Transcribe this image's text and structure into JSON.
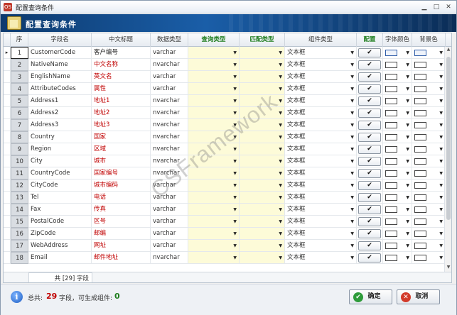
{
  "window": {
    "title": "配置查询条件",
    "app_icon": "OS"
  },
  "banner": {
    "title": "配置查询条件"
  },
  "grid": {
    "headers": {
      "seq": "序",
      "field": "字段名",
      "cn": "中文标题",
      "type": "数据类型",
      "query": "查询类型",
      "match": "匹配类型",
      "comp": "组件类型",
      "cfg": "配置",
      "fc": "字体颜色",
      "bg": "背景色"
    },
    "rows": [
      {
        "seq": "1",
        "field": "CustomerCode",
        "cn": "客户编号",
        "type": "varchar",
        "comp": "文本框"
      },
      {
        "seq": "2",
        "field": "NativeName",
        "cn": "中文名称",
        "type": "nvarchar",
        "comp": "文本框"
      },
      {
        "seq": "3",
        "field": "EnglishName",
        "cn": "英文名",
        "type": "varchar",
        "comp": "文本框"
      },
      {
        "seq": "4",
        "field": "AttributeCodes",
        "cn": "属性",
        "type": "varchar",
        "comp": "文本框"
      },
      {
        "seq": "5",
        "field": "Address1",
        "cn": "地址1",
        "type": "nvarchar",
        "comp": "文本框"
      },
      {
        "seq": "6",
        "field": "Address2",
        "cn": "地址2",
        "type": "nvarchar",
        "comp": "文本框"
      },
      {
        "seq": "7",
        "field": "Address3",
        "cn": "地址3",
        "type": "nvarchar",
        "comp": "文本框"
      },
      {
        "seq": "8",
        "field": "Country",
        "cn": "国家",
        "type": "nvarchar",
        "comp": "文本框"
      },
      {
        "seq": "9",
        "field": "Region",
        "cn": "区域",
        "type": "nvarchar",
        "comp": "文本框"
      },
      {
        "seq": "10",
        "field": "City",
        "cn": "城市",
        "type": "nvarchar",
        "comp": "文本框"
      },
      {
        "seq": "11",
        "field": "CountryCode",
        "cn": "国家编号",
        "type": "nvarchar",
        "comp": "文本框"
      },
      {
        "seq": "12",
        "field": "CityCode",
        "cn": "城市编码",
        "type": "varchar",
        "comp": "文本框"
      },
      {
        "seq": "13",
        "field": "Tel",
        "cn": "电话",
        "type": "varchar",
        "comp": "文本框"
      },
      {
        "seq": "14",
        "field": "Fax",
        "cn": "传真",
        "type": "varchar",
        "comp": "文本框"
      },
      {
        "seq": "15",
        "field": "PostalCode",
        "cn": "区号",
        "type": "varchar",
        "comp": "文本框"
      },
      {
        "seq": "16",
        "field": "ZipCode",
        "cn": "邮编",
        "type": "varchar",
        "comp": "文本框"
      },
      {
        "seq": "17",
        "field": "WebAddress",
        "cn": "网址",
        "type": "varchar",
        "comp": "文本框"
      },
      {
        "seq": "18",
        "field": "Email",
        "cn": "邮件地址",
        "type": "nvarchar",
        "comp": "文本框"
      }
    ],
    "check_mark": "✔",
    "dropdown_arrow": "▼",
    "row_indicator": "▸",
    "footer": "共 [29] 字段"
  },
  "watermark": "CSFramework",
  "summary": {
    "label_total": "总共:",
    "total": "29",
    "label_mid": "字段，可生成组件:",
    "components": "0",
    "total_color": "#c00000",
    "components_color": "#1e7d1e"
  },
  "buttons": {
    "ok": {
      "label": "确定",
      "icon": "check-icon",
      "color": "#2e9b3a"
    },
    "cancel": {
      "label": "取消",
      "icon": "cancel-icon",
      "color": "#d23a2a"
    }
  }
}
